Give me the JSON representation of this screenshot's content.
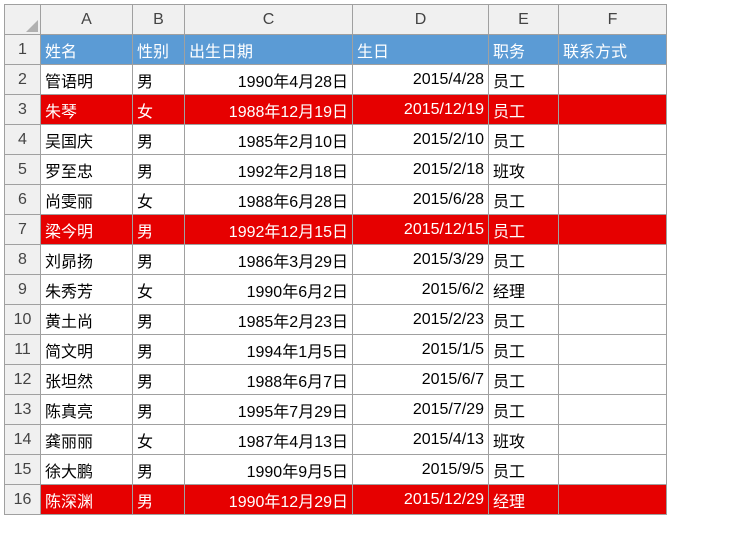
{
  "columns": [
    "A",
    "B",
    "C",
    "D",
    "E",
    "F"
  ],
  "rowNumbers": [
    1,
    2,
    3,
    4,
    5,
    6,
    7,
    8,
    9,
    10,
    11,
    12,
    13,
    14,
    15,
    16
  ],
  "headers": {
    "name": "姓名",
    "gender": "性别",
    "birthdate": "出生日期",
    "birthday": "生日",
    "position": "职务",
    "contact": "联系方式"
  },
  "rows": [
    {
      "name": "管语明",
      "gender": "男",
      "birthdate": "1990年4月28日",
      "birthday": "2015/4/28",
      "position": "员工",
      "contact": "",
      "highlight": false
    },
    {
      "name": "朱琴",
      "gender": "女",
      "birthdate": "1988年12月19日",
      "birthday": "2015/12/19",
      "position": "员工",
      "contact": "",
      "highlight": true
    },
    {
      "name": "吴国庆",
      "gender": "男",
      "birthdate": "1985年2月10日",
      "birthday": "2015/2/10",
      "position": "员工",
      "contact": "",
      "highlight": false
    },
    {
      "name": "罗至忠",
      "gender": "男",
      "birthdate": "1992年2月18日",
      "birthday": "2015/2/18",
      "position": "班攻",
      "contact": "",
      "highlight": false
    },
    {
      "name": "尚雯丽",
      "gender": "女",
      "birthdate": "1988年6月28日",
      "birthday": "2015/6/28",
      "position": "员工",
      "contact": "",
      "highlight": false
    },
    {
      "name": "梁今明",
      "gender": "男",
      "birthdate": "1992年12月15日",
      "birthday": "2015/12/15",
      "position": "员工",
      "contact": "",
      "highlight": true
    },
    {
      "name": "刘昴扬",
      "gender": "男",
      "birthdate": "1986年3月29日",
      "birthday": "2015/3/29",
      "position": "员工",
      "contact": "",
      "highlight": false
    },
    {
      "name": "朱秀芳",
      "gender": "女",
      "birthdate": "1990年6月2日",
      "birthday": "2015/6/2",
      "position": "经理",
      "contact": "",
      "highlight": false
    },
    {
      "name": "黄土尚",
      "gender": "男",
      "birthdate": "1985年2月23日",
      "birthday": "2015/2/23",
      "position": "员工",
      "contact": "",
      "highlight": false
    },
    {
      "name": "简文明",
      "gender": "男",
      "birthdate": "1994年1月5日",
      "birthday": "2015/1/5",
      "position": "员工",
      "contact": "",
      "highlight": false
    },
    {
      "name": "张坦然",
      "gender": "男",
      "birthdate": "1988年6月7日",
      "birthday": "2015/6/7",
      "position": "员工",
      "contact": "",
      "highlight": false
    },
    {
      "name": "陈真亮",
      "gender": "男",
      "birthdate": "1995年7月29日",
      "birthday": "2015/7/29",
      "position": "员工",
      "contact": "",
      "highlight": false
    },
    {
      "name": "龚丽丽",
      "gender": "女",
      "birthdate": "1987年4月13日",
      "birthday": "2015/4/13",
      "position": "班攻",
      "contact": "",
      "highlight": false
    },
    {
      "name": "徐大鹏",
      "gender": "男",
      "birthdate": "1990年9月5日",
      "birthday": "2015/9/5",
      "position": "员工",
      "contact": "",
      "highlight": false
    },
    {
      "name": "陈深渊",
      "gender": "男",
      "birthdate": "1990年12月29日",
      "birthday": "2015/12/29",
      "position": "经理",
      "contact": "",
      "highlight": true
    }
  ]
}
